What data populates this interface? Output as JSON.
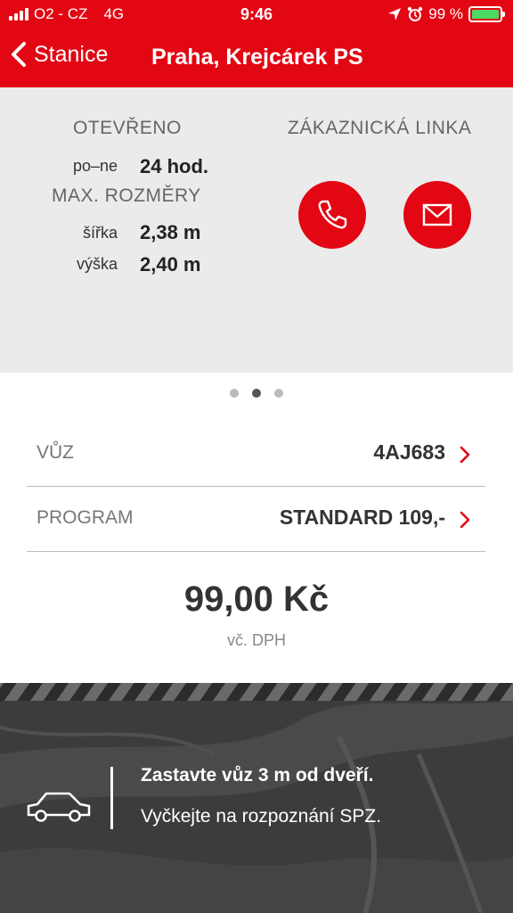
{
  "status_bar": {
    "carrier": "O2 - CZ",
    "network": "4G",
    "time": "9:46",
    "battery_percent": "99 %",
    "battery_level": 0.99
  },
  "nav": {
    "back_label": "Stanice",
    "title": "Praha, Krejcárek PS"
  },
  "info": {
    "open_heading": "OTEVŘENO",
    "hours_label": "po–ne",
    "hours_value": "24 hod.",
    "dimensions_heading": "MAX. ROZMĚRY",
    "width_label": "šířka",
    "width_value": "2,38 m",
    "height_label": "výška",
    "height_value": "2,40 m",
    "contact_heading": "ZÁKAZNICKÁ LINKA"
  },
  "pager": {
    "count": 3,
    "active": 1
  },
  "rows": {
    "car_label": "VŮZ",
    "car_value": "4AJ683",
    "program_label": "PROGRAM",
    "program_value": "STANDARD 109,-"
  },
  "price": {
    "amount": "99,00 Kč",
    "vat_note": "vč. DPH"
  },
  "instructions": {
    "line1": "Zastavte vůz 3 m od dveří.",
    "line2": "Vyčkejte na rozpoznání SPZ."
  },
  "colors": {
    "brand_red": "#e30613",
    "panel_gray": "#ebebeb",
    "battery_green": "#4cd964"
  },
  "icons": [
    "signal-icon",
    "location-arrow-icon",
    "alarm-icon",
    "battery-icon",
    "back-chevron-icon",
    "phone-icon",
    "mail-icon",
    "chevron-right-icon",
    "car-icon"
  ]
}
